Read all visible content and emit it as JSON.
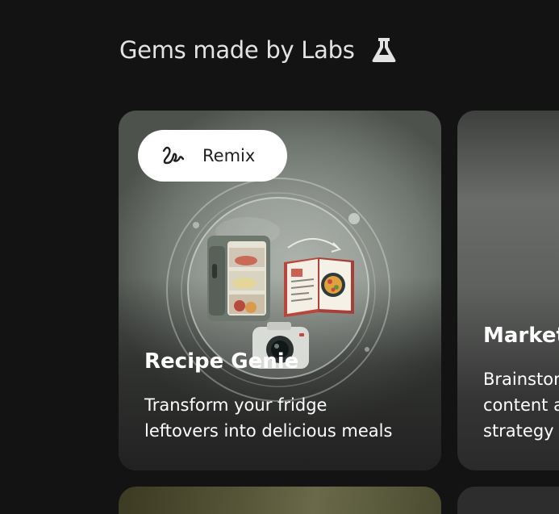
{
  "section": {
    "title": "Gems made by Labs",
    "icon": "flask-icon"
  },
  "cards": [
    {
      "remix_label": "Remix",
      "remix_icon": "remix-squiggle-icon",
      "title": "Recipe Genie",
      "description_line1": "Transform your fridge",
      "description_line2": "leftovers into delicious meals"
    },
    {
      "title": "Market",
      "description_line1": "Brainstor",
      "description_line2": "content a",
      "description_line3": "strategy"
    }
  ],
  "colors": {
    "background": "#131314",
    "heading_text": "#e3e3e3",
    "card_text": "#ffffff",
    "remix_bg": "#ffffff"
  }
}
